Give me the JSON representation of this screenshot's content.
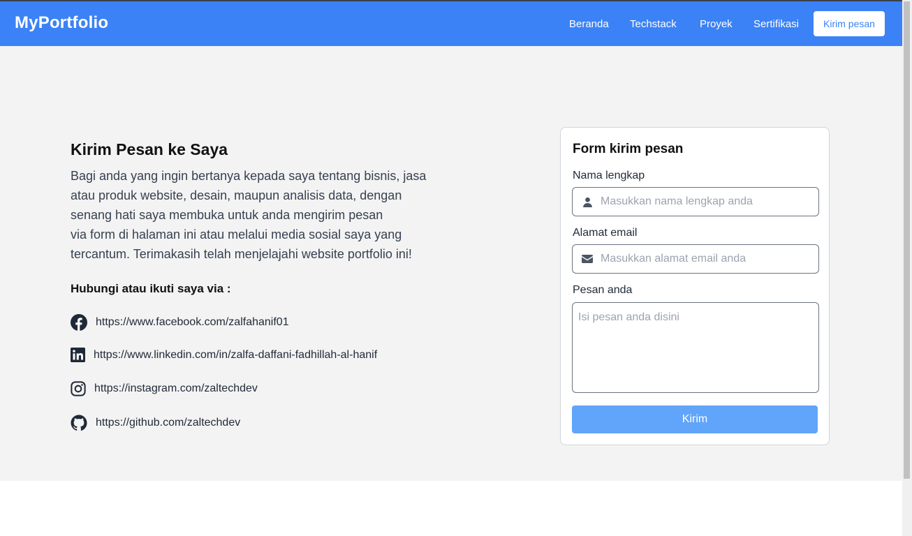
{
  "navbar": {
    "brand": "MyPortfolio",
    "items": [
      "Beranda",
      "Techstack",
      "Proyek",
      "Sertifikasi"
    ],
    "cta": "Kirim pesan"
  },
  "contact": {
    "title": "Kirim Pesan ke Saya",
    "intro_lines": [
      "Bagi anda yang ingin bertanya kepada saya tentang bisnis, jasa",
      "atau produk website, desain, maupun analisis data, dengan",
      "senang hati saya membuka untuk anda mengirim pesan",
      "via form di halaman ini atau melalui media sosial saya yang",
      "tercantum. Terimakasih telah menjelajahi website portfolio ini!"
    ],
    "follow_title": "Hubungi atau ikuti saya via :",
    "socials": [
      {
        "icon": "facebook-icon",
        "url": "https://www.facebook.com/zalfahanif01"
      },
      {
        "icon": "linkedin-icon",
        "url": "https://www.linkedin.com/in/zalfa-daffani-fadhillah-al-hanif"
      },
      {
        "icon": "instagram-icon",
        "url": "https://instagram.com/zaltechdev"
      },
      {
        "icon": "github-icon",
        "url": "https://github.com/zaltechdev"
      }
    ]
  },
  "form": {
    "title": "Form kirim pesan",
    "name_label": "Nama lengkap",
    "name_placeholder": "Masukkan nama lengkap anda",
    "name_value": "",
    "email_label": "Alamat email",
    "email_placeholder": "Masukkan alamat email anda",
    "email_value": "",
    "message_label": "Pesan anda",
    "message_placeholder": "Isi pesan anda disini",
    "message_value": "",
    "submit_label": "Kirim"
  },
  "colors": {
    "primary": "#3b82f6",
    "submit": "#60a5fa",
    "background": "#f3f3f3"
  }
}
